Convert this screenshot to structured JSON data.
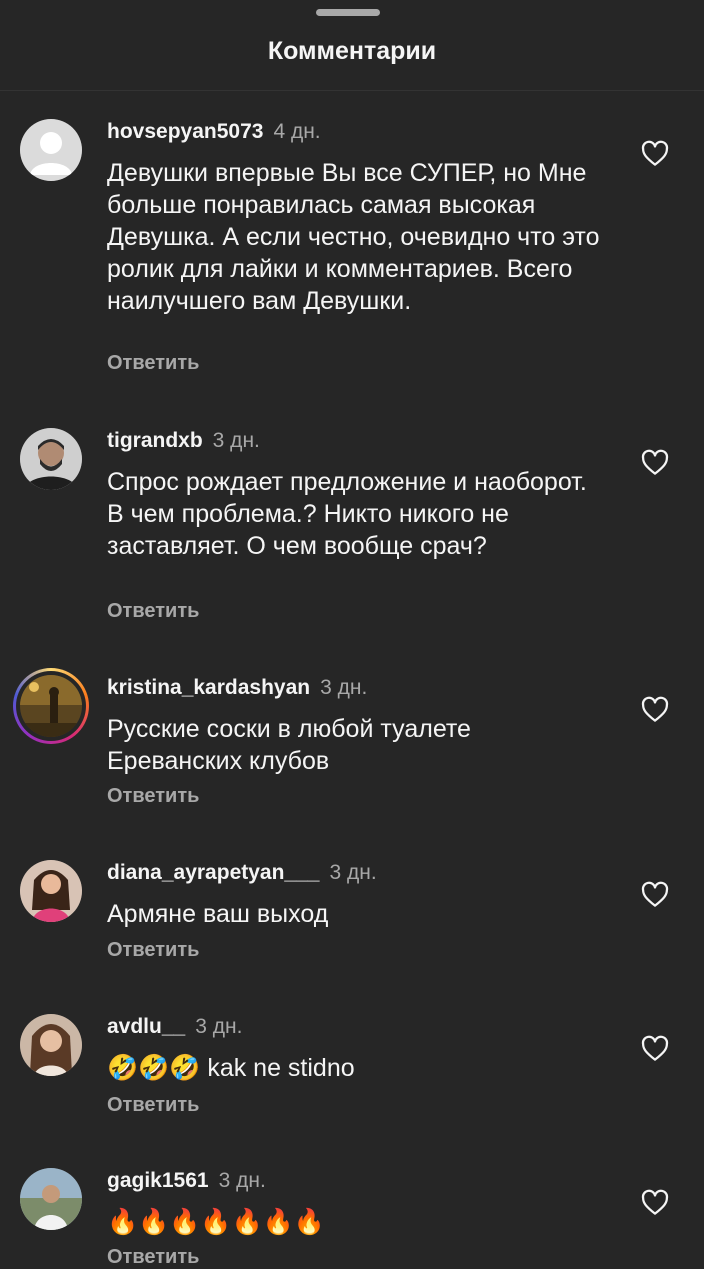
{
  "header": {
    "title": "Комментарии"
  },
  "comments": [
    {
      "username": "hovsepyan5073",
      "time": "4 дн.",
      "text": "Девушки впервые Вы все СУПЕР, но Мне больше понравилась самая высокая Девушка. А если честно, очевидно что это ролик для лайки и комментариев. Всего наилучшего вам Девушки.",
      "reply_label": "Ответить"
    },
    {
      "username": "tigrandxb",
      "time": "3 дн.",
      "text": "Спрос рождает предложение и наоборот. В чем проблема.? Никто никого не заставляет. О чем вообще срач?",
      "reply_label": "Ответить"
    },
    {
      "username": "kristina_kardashyan",
      "time": "3 дн.",
      "text": "Русские соски в любой туалете Ереванских клубов",
      "reply_label": "Ответить"
    },
    {
      "username": "diana_ayrapetyan___",
      "time": "3 дн.",
      "text": "Армяне ваш выход",
      "reply_label": "Ответить"
    },
    {
      "username": "avdlu__",
      "time": "3 дн.",
      "text": "🤣🤣🤣 kak ne stidno",
      "reply_label": "Ответить"
    },
    {
      "username": "gagik1561",
      "time": "3 дн.",
      "text": "🔥🔥🔥🔥🔥🔥🔥",
      "reply_label": "Ответить"
    }
  ]
}
